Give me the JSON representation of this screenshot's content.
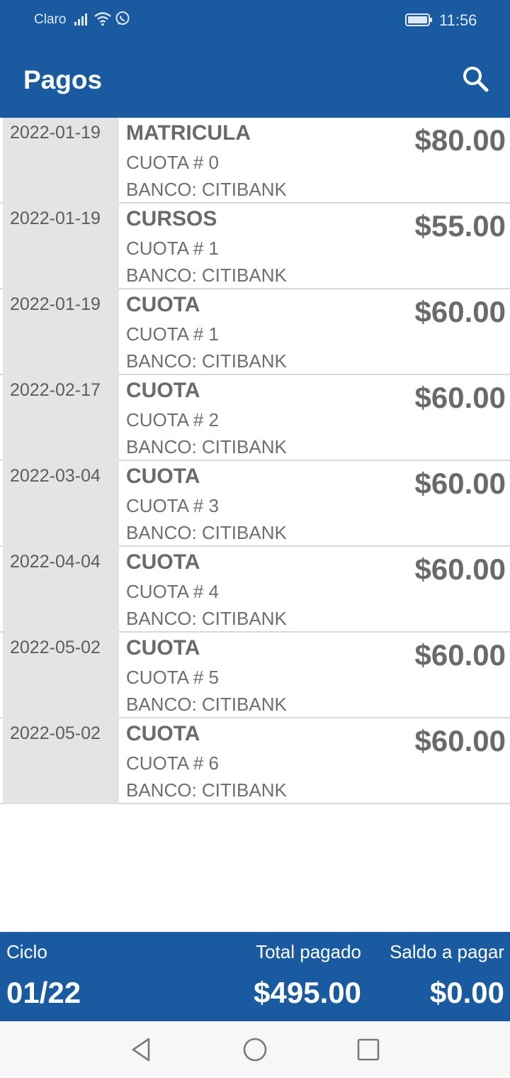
{
  "status_bar": {
    "carrier": "Claro",
    "time": "11:56"
  },
  "app_bar": {
    "title": "Pagos",
    "action_icon": "search-icon"
  },
  "payments": [
    {
      "date": "2022-01-19",
      "concept": "MATRICULA",
      "cuota": "CUOTA # 0",
      "bank": "BANCO: CITIBANK",
      "amount": "$80.00"
    },
    {
      "date": "2022-01-19",
      "concept": "CURSOS",
      "cuota": "CUOTA # 1",
      "bank": "BANCO: CITIBANK",
      "amount": "$55.00"
    },
    {
      "date": "2022-01-19",
      "concept": "CUOTA",
      "cuota": "CUOTA # 1",
      "bank": "BANCO: CITIBANK",
      "amount": "$60.00"
    },
    {
      "date": "2022-02-17",
      "concept": "CUOTA",
      "cuota": "CUOTA # 2",
      "bank": "BANCO: CITIBANK",
      "amount": "$60.00"
    },
    {
      "date": "2022-03-04",
      "concept": "CUOTA",
      "cuota": "CUOTA # 3",
      "bank": "BANCO: CITIBANK",
      "amount": "$60.00"
    },
    {
      "date": "2022-04-04",
      "concept": "CUOTA",
      "cuota": "CUOTA # 4",
      "bank": "BANCO: CITIBANK",
      "amount": "$60.00"
    },
    {
      "date": "2022-05-02",
      "concept": "CUOTA",
      "cuota": "CUOTA # 5",
      "bank": "BANCO: CITIBANK",
      "amount": "$60.00"
    },
    {
      "date": "2022-05-02",
      "concept": "CUOTA",
      "cuota": "CUOTA # 6",
      "bank": "BANCO: CITIBANK",
      "amount": "$60.00"
    }
  ],
  "footer": {
    "ciclo_label": "Ciclo",
    "ciclo_value": "01/22",
    "total_label": "Total pagado",
    "total_value": "$495.00",
    "saldo_label": "Saldo a pagar",
    "saldo_value": "$0.00"
  },
  "colors": {
    "primary": "#1a5aa0",
    "date_bg": "#e3e4e6",
    "text": "#6a6a6a"
  }
}
